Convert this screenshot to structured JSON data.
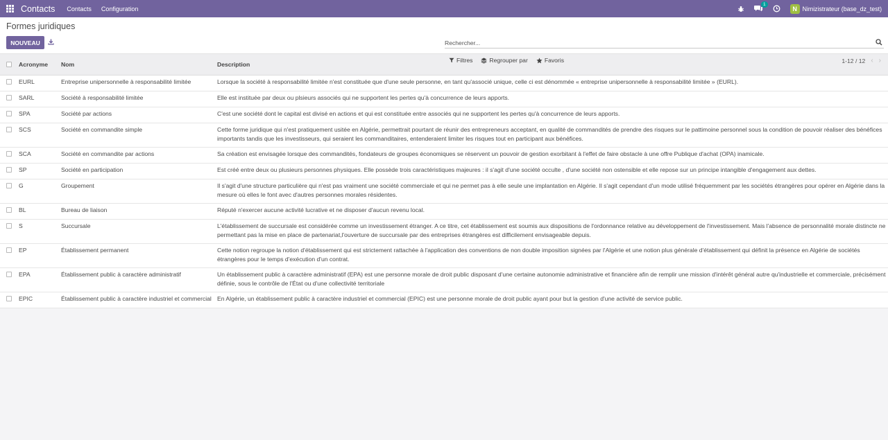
{
  "navbar": {
    "app_name": "Contacts",
    "menu": [
      "Contacts",
      "Configuration"
    ],
    "messages_badge": "1",
    "user_initial": "N",
    "user_label": "Nimizistrateur (base_dz_test)"
  },
  "control": {
    "title": "Formes juridiques",
    "new_label": "NOUVEAU",
    "search_placeholder": "Rechercher...",
    "filters_label": "Filtres",
    "group_by_label": "Regrouper par",
    "favorites_label": "Favoris",
    "pager_text": "1-12 / 12"
  },
  "table": {
    "headers": {
      "acronym": "Acronyme",
      "name": "Nom",
      "description": "Description"
    },
    "rows": [
      {
        "acronym": "EURL",
        "name": "Entreprise unipersonnelle à responsabilité limitée",
        "description": "Lorsque la société à responsabilité limitée n'est constituée que d'une seule personne, en tant qu'associé unique, celle ci est dénommée « entreprise unipersonnelle à responsabilité limitée » (EURL)."
      },
      {
        "acronym": "SARL",
        "name": "Société à responsabilité limitée",
        "description": "Elle est instituée par deux ou plsieurs associés qui ne supportent les pertes qu'à concurrence de leurs apports."
      },
      {
        "acronym": "SPA",
        "name": "Société par actions",
        "description": "C'est une société dont le capital est divisé en actions et qui est constituée entre associés qui ne supportent les pertes qu'à concurrence de leurs apports."
      },
      {
        "acronym": "SCS",
        "name": "Société en commandite simple",
        "description": "Cette forme juridique qui n'est pratiquement usitée en Algérie, permettrait pourtant de réunir des entrepreneurs acceptant, en qualité de commandités de prendre des risques sur le pattimoine personnel sous la condition de pouvoir réaliser des bénéfices importants tandis que les investisseurs, qui seraient les commanditaires, entenderaient limiter les risques tout en participant aux bénéfices."
      },
      {
        "acronym": "SCA",
        "name": "Société en commandite par actions",
        "description": "Sa création est envisagée lorsque des commandités, fondateurs de groupes économiques se réservent un pouvoir de gestion exorbitant à l'effet de faire obstacle à une offre Publique d'achat (OPA) inamicale."
      },
      {
        "acronym": "SP",
        "name": "Société en participation",
        "description": "Est créé entre deux ou plusieurs personnes physiques. Elle possède trois caractéristiques majeures : il s'agit d'une société occulte , d'une société non ostensible et elle repose sur un principe intangible d'engagement aux dettes."
      },
      {
        "acronym": "G",
        "name": "Groupement",
        "description": "Il s'agit d'une structure particulière qui n'est pas vraiment une société commerciale et qui ne permet pas à elle seule une implantation en Algérie. Il s'agit cependant d'un mode utilisé fréquemment par les sociétés étrangères pour opérer en Algérie dans la mesure où elles le font avec d'autres personnes morales résidentes."
      },
      {
        "acronym": "BL",
        "name": "Bureau de liaison",
        "description": "Réputé n'exercer aucune activité lucrative et ne disposer d'aucun revenu local."
      },
      {
        "acronym": "S",
        "name": "Succursale",
        "description": "L'établissement de succursale est considérée comme un investissement étranger. A ce titre, cet établissement est soumis aux dispositions de l'ordonnance relative au développement de l'investissement. Mais l'absence de personnalité morale distincte ne permettant pas la mise en place de partenariat,l'ouverture de succursale par des entreprises étrangères est difficilement envisageable depuis."
      },
      {
        "acronym": "EP",
        "name": "Établissement permanent",
        "description": "Cette notion regroupe la notion d'établissement qui est strictement rattachée à l'application des conventions de non double imposition signées par l'Algérie et une notion plus générale d'établissement qui définit la présence en Algérie de sociétés étrangères pour le temps d'exécution d'un contrat."
      },
      {
        "acronym": "EPA",
        "name": "Établissement public à caractère administratif",
        "description": "Un établissement public à caractère administratif (EPA) est une personne morale de droit public disposant d'une certaine autonomie administrative et financière afin de remplir une mission d'intérêt général autre qu'industrielle et commerciale, précisément définie, sous le contrôle de l'État ou d'une collectivité territoriale"
      },
      {
        "acronym": "EPIC",
        "name": "Établissement public à caractère industriel et commercial",
        "description": "En Algérie, un établissement public à caractère industriel et commercial (EPIC) est une personne morale de droit public ayant pour but la gestion d'une activité de service public."
      }
    ]
  }
}
